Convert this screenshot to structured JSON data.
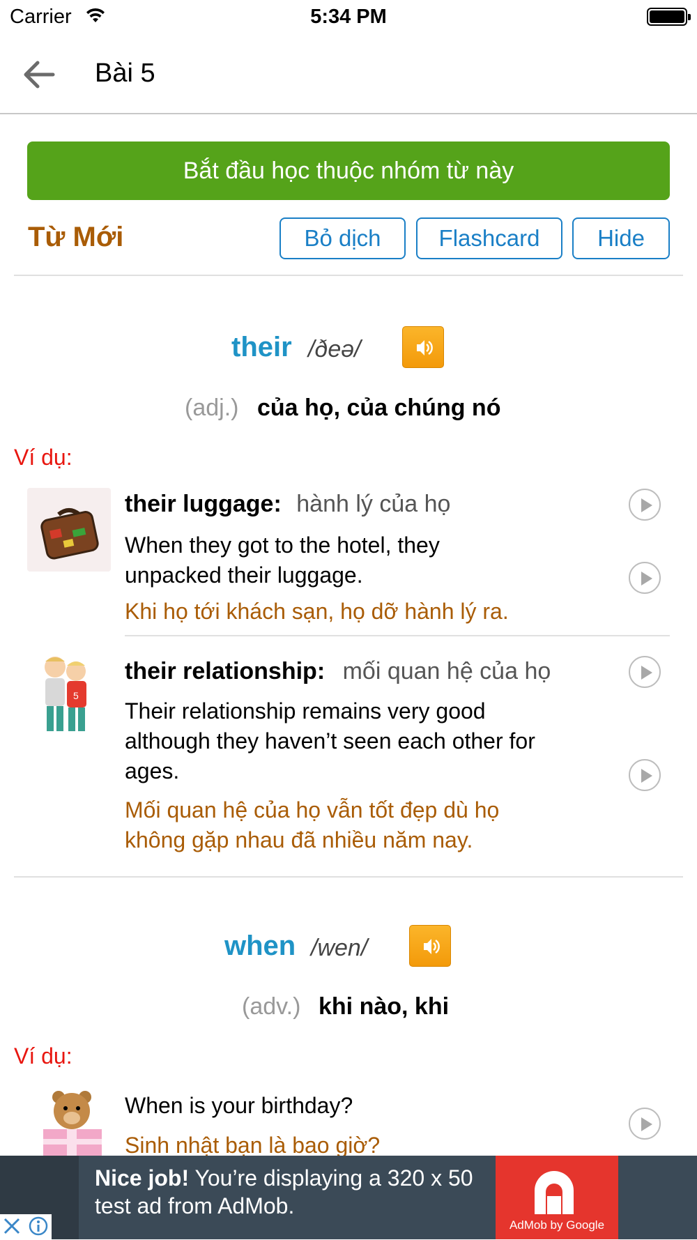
{
  "status_bar": {
    "carrier": "Carrier",
    "time": "5:34 PM"
  },
  "nav": {
    "title": "Bài 5",
    "back_icon": "arrow-left-icon"
  },
  "start_button": "Bắt đầu học thuộc nhóm từ này",
  "section": {
    "title": "Từ Mới",
    "buttons": [
      "Bỏ dịch",
      "Flashcard",
      "Hide"
    ]
  },
  "words": [
    {
      "word": "their",
      "phonetic": "/ðeə/",
      "pos": "(adj.)",
      "meaning": "của họ, của chúng nó",
      "example_label": "Ví dụ:",
      "examples": [
        {
          "phrase": "their luggage:",
          "phrase_translation": "hành lý của họ",
          "sentence": [
            "When  they got to the hotel, they",
            "unpacked their luggage."
          ],
          "translation": [
            "Khi họ tới khách sạn, họ dỡ hành lý ra."
          ],
          "image": "luggage-icon"
        },
        {
          "phrase": "their relationship:",
          "phrase_translation": "mối quan hệ của họ",
          "sentence": [
            "Their relationship remains very good",
            "although they  haven’t seen each other for",
            "ages."
          ],
          "translation": [
            "Mối quan hệ của họ vẫn tốt đẹp dù họ",
            "không gặp nhau đã nhiều năm nay."
          ],
          "image": "friends-icon"
        }
      ]
    },
    {
      "word": "when",
      "phonetic": "/wen/",
      "pos": "(adv.)",
      "meaning": "khi nào, khi",
      "example_label": "Ví dụ:",
      "examples": [
        {
          "sentence": [
            "When is your birthday?"
          ],
          "translation": [
            "Sinh nhật bạn là bao giờ?"
          ],
          "image": "teddy-bear-gift-icon"
        }
      ]
    }
  ],
  "ad": {
    "headline": "Nice job!",
    "body": "You’re displaying a 320 x 50 test ad from AdMob.",
    "brand": "AdMob by Google"
  }
}
